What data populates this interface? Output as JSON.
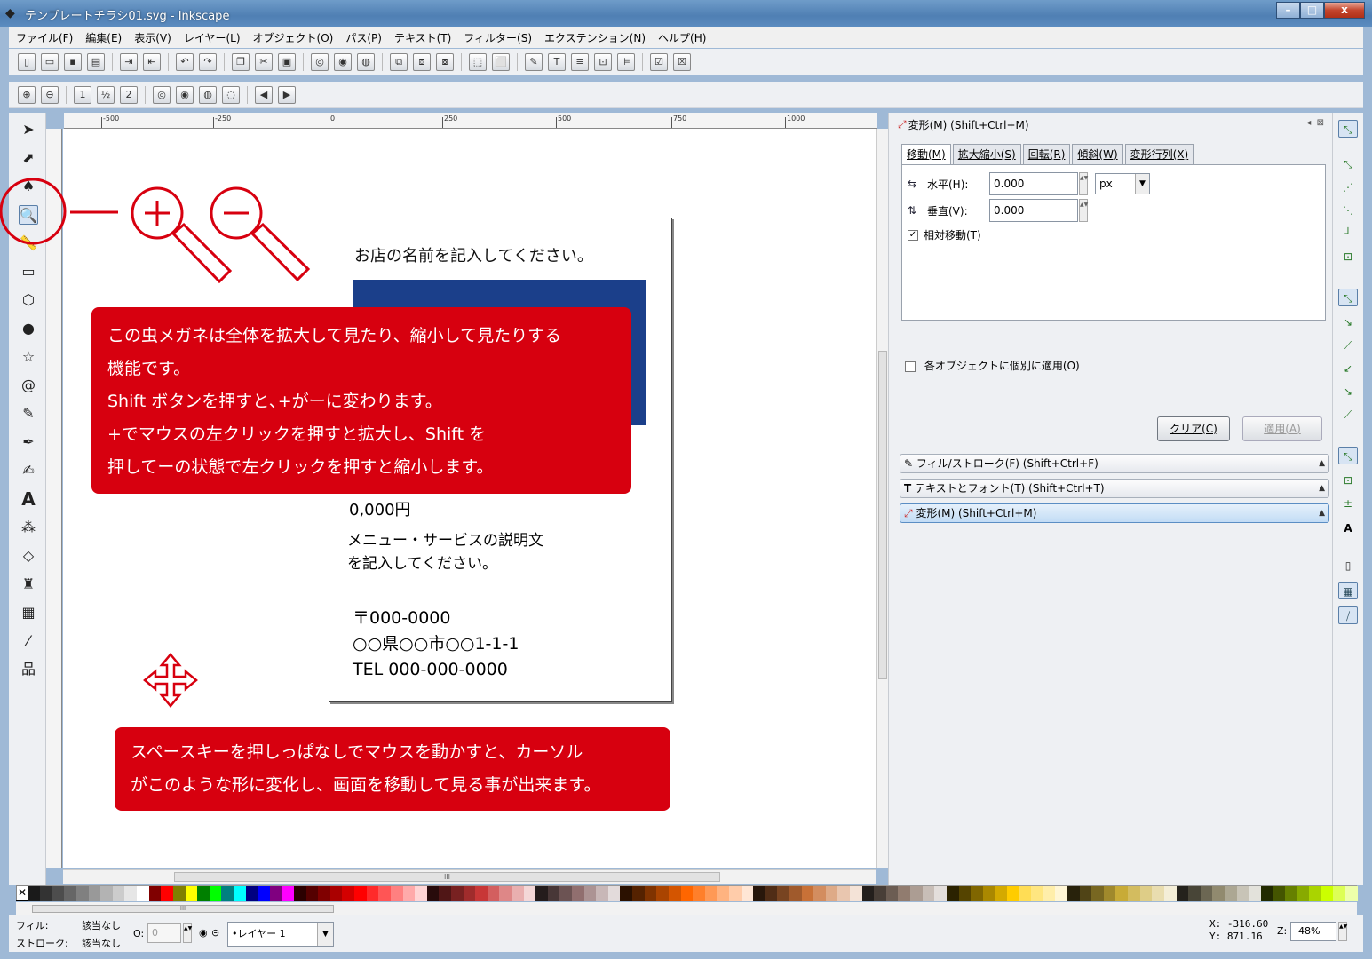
{
  "window": {
    "title": "テンプレートチラシ01.svg - Inkscape",
    "min": "–",
    "max": "□",
    "close": "x"
  },
  "menu": [
    "ファイル(F)",
    "編集(E)",
    "表示(V)",
    "レイヤー(L)",
    "オブジェクト(O)",
    "パス(P)",
    "テキスト(T)",
    "フィルター(S)",
    "エクステンション(N)",
    "ヘルプ(H)"
  ],
  "ruler": {
    "labels": [
      "-500",
      "-250",
      "0",
      "250",
      "500",
      "750",
      "1000"
    ]
  },
  "flyer": {
    "shop_name": "お店の名前を記入してください。",
    "price": "0,000円",
    "desc_line1": "メニュー・サービスの説明文",
    "desc_line2": "を記入してください。",
    "zip": "〒000-0000",
    "address": "○○県○○市○○1-1-1",
    "tel": "TEL 000-000-0000"
  },
  "callouts": {
    "zoom_line1": "この虫メガネは全体を拡大して見たり、縮小して見たりする",
    "zoom_line2": "機能です。",
    "zoom_line3": "Shift ボタンを押すと､+がーに変わります。",
    "zoom_line4": "+でマウスの左クリックを押すと拡大し、Shift を",
    "zoom_line5": "押してーの状態で左クリックを押すと縮小します。",
    "pan_line1": "スペースキーを押しっぱなしでマウスを動かすと、カーソル",
    "pan_line2": "がこのような形に変化し、画面を移動して見る事が出来ます。"
  },
  "transform_panel": {
    "title": "変形(M) (Shift+Ctrl+M)",
    "tabs": [
      "移動(M)",
      "拡大縮小(S)",
      "回転(R)",
      "傾斜(W)",
      "変形行列(X)"
    ],
    "horizontal_label": "水平(H):",
    "horizontal_value": "0.000",
    "vertical_label": "垂直(V):",
    "vertical_value": "0.000",
    "unit": "px",
    "relative_move": "相対移動(T)",
    "apply_each": "各オブジェクトに個別に適用(O)",
    "clear_button": "クリア(C)",
    "apply_button": "適用(A)"
  },
  "dock_bars": [
    "フィル/ストローク(F) (Shift+Ctrl+F)",
    "テキストとフォント(T) (Shift+Ctrl+T)",
    "変形(M) (Shift+Ctrl+M)"
  ],
  "palette_colors": [
    "#000000",
    "#1a1a1a",
    "#333333",
    "#4d4d4d",
    "#666666",
    "#808080",
    "#999999",
    "#b3b3b3",
    "#cccccc",
    "#e6e6e6",
    "#ffffff",
    "#800000",
    "#ff0000",
    "#808000",
    "#ffff00",
    "#008000",
    "#00ff00",
    "#008080",
    "#00ffff",
    "#000080",
    "#0000ff",
    "#800080",
    "#ff00ff",
    "#2b0000",
    "#550000",
    "#800000",
    "#aa0000",
    "#d40000",
    "#ff0000",
    "#ff2a2a",
    "#ff5555",
    "#ff8080",
    "#ffaaaa",
    "#ffd5d5",
    "#280b0b",
    "#501616",
    "#782121",
    "#a02c2c",
    "#c83737",
    "#d35f5f",
    "#de8787",
    "#e9afaf",
    "#f4d7d7",
    "#241c1c",
    "#483737",
    "#6c5353",
    "#916f6f",
    "#ac9393",
    "#c8b7b7",
    "#e3dbdb",
    "#2b1100",
    "#552200",
    "#803300",
    "#aa4400",
    "#d45500",
    "#ff6600",
    "#ff7f2a",
    "#ff9955",
    "#ffb380",
    "#ffccaa",
    "#ffe6d5",
    "#28170b",
    "#502d16",
    "#784421",
    "#a05a2c",
    "#c87137",
    "#d38d5f",
    "#deaa87",
    "#e9c6af",
    "#f4e3d7",
    "#241f1c",
    "#483e37",
    "#6c5d53",
    "#917c6f",
    "#ac9d93",
    "#c8beb7",
    "#e3dedb",
    "#2b2200",
    "#554400",
    "#806600",
    "#aa8800",
    "#d4aa00",
    "#ffcc00",
    "#ffdd55",
    "#ffe680",
    "#ffeeaa",
    "#fff6d5",
    "#28220b",
    "#504416",
    "#786721",
    "#a0892c",
    "#c8ab37",
    "#d3bc5f",
    "#decd87",
    "#e9ddaf",
    "#f4eed7",
    "#24221c",
    "#484537",
    "#6c6753",
    "#918a6f",
    "#aca793",
    "#c8c4b7",
    "#e3e2db",
    "#222b00",
    "#445500",
    "#668000",
    "#88aa00",
    "#aad400",
    "#ccff00",
    "#ddff55",
    "#eeffaa"
  ],
  "status": {
    "fill_label": "フィル:",
    "fill_value": "該当なし",
    "stroke_label": "ストローク:",
    "stroke_value": "該当なし",
    "opacity_label": "O:",
    "opacity_value": "0",
    "layer": "•レイヤー 1",
    "x_coord": "X: -316.60",
    "y_coord": "Y:  871.16",
    "zoom_label": "Z:",
    "zoom_value": "48%"
  },
  "accent_color": "#d7000f"
}
